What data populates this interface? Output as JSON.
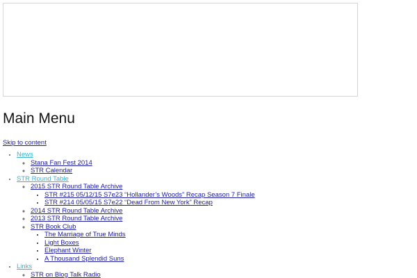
{
  "page_title": "Main Menu",
  "skip_link": "Skip to content",
  "menu": [
    {
      "label": "News",
      "children": [
        {
          "label": "Stana Fan Fest 2014"
        },
        {
          "label": "STR Calendar"
        }
      ]
    },
    {
      "label": "STR Round Table",
      "children": [
        {
          "label": "2015 STR Round Table Archive",
          "children": [
            {
              "label": "STR #215 05/12/15 S7e23 “Hollander’s Woods” Recap Season 7 Finale"
            },
            {
              "label": "STR #214 05/05/15 S7e22 “Dead From New York” Recap"
            }
          ]
        },
        {
          "label": "2014 STR Round Table Archive"
        },
        {
          "label": "2013 STR Round Table Archive"
        },
        {
          "label": "STR Book Club",
          "children": [
            {
              "label": "The Marriage of True Minds"
            },
            {
              "label": "Light Boxes"
            },
            {
              "label": "Elephant Winter"
            },
            {
              "label": "A Thousand Splendid Suns"
            }
          ]
        }
      ]
    },
    {
      "label": "Links",
      "children": [
        {
          "label": "STR on Blog Talk Radio"
        }
      ]
    }
  ]
}
